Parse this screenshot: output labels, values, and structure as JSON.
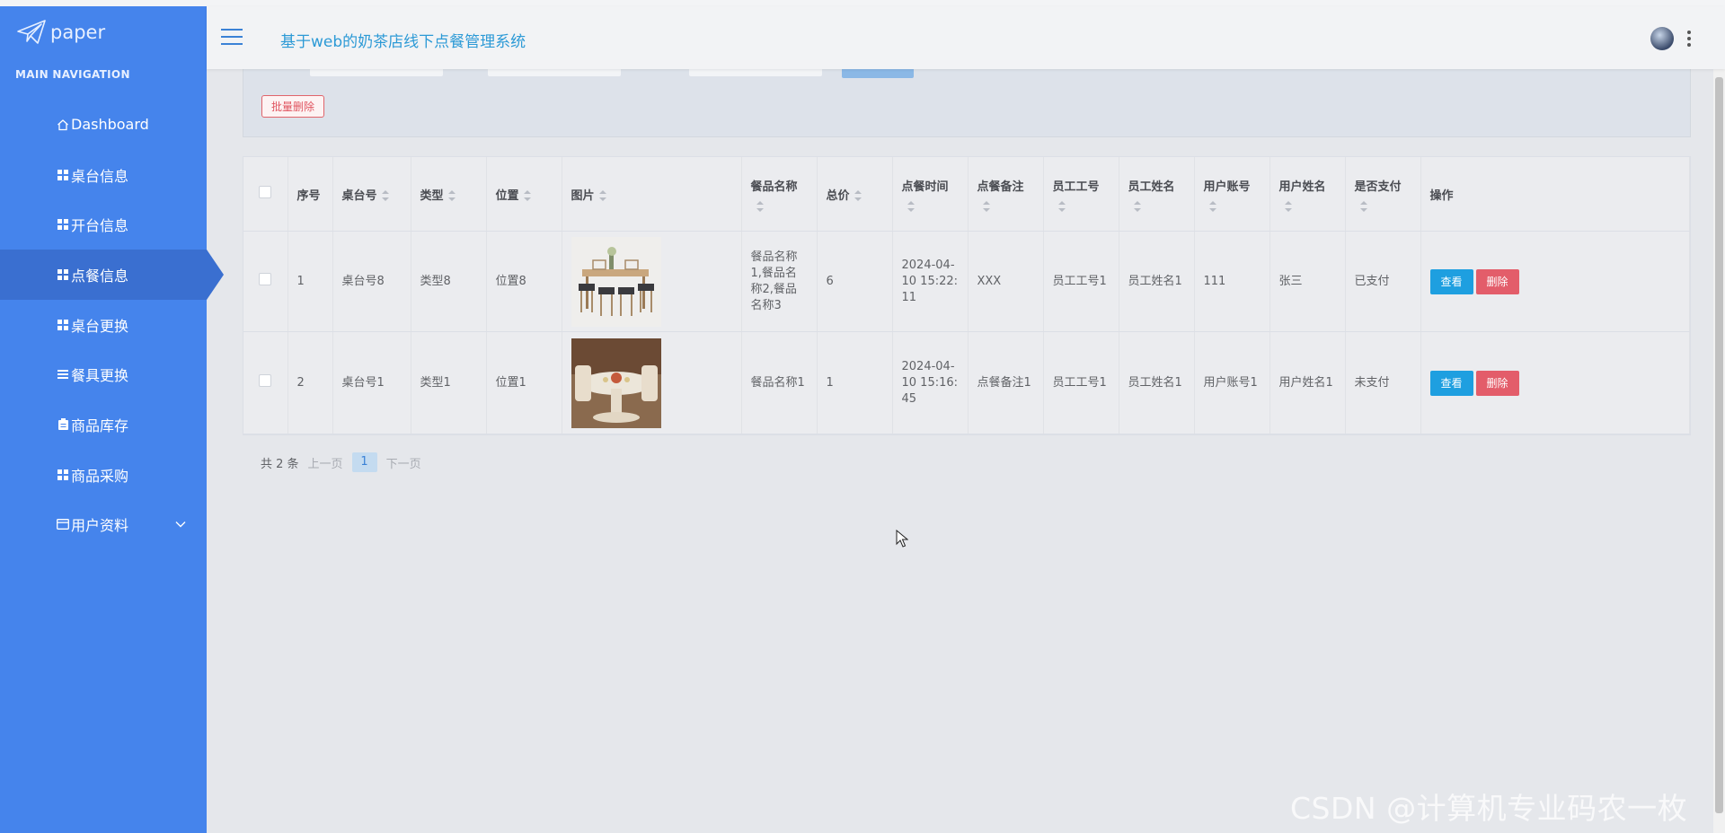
{
  "brand": {
    "logo_text": "paper"
  },
  "sidebar": {
    "nav_title": "MAIN NAVIGATION",
    "items": [
      {
        "label": "Dashboard",
        "icon": "home-icon"
      },
      {
        "label": "桌台信息",
        "icon": "grid-icon"
      },
      {
        "label": "开台信息",
        "icon": "grid-icon"
      },
      {
        "label": "点餐信息",
        "icon": "grid-icon",
        "active": true
      },
      {
        "label": "桌台更换",
        "icon": "grid-icon"
      },
      {
        "label": "餐具更换",
        "icon": "list-icon"
      },
      {
        "label": "商品库存",
        "icon": "clipboard-icon"
      },
      {
        "label": "商品采购",
        "icon": "grid-icon"
      },
      {
        "label": "用户资料",
        "icon": "card-icon",
        "expandable": true
      }
    ]
  },
  "header": {
    "title": "基于web的奶茶店线下点餐管理系统"
  },
  "toolbar": {
    "batch_delete_label": "批量删除"
  },
  "table": {
    "columns": [
      "序号",
      "桌台号",
      "类型",
      "位置",
      "图片",
      "餐品名称",
      "总价",
      "点餐时间",
      "点餐备注",
      "员工工号",
      "员工姓名",
      "用户账号",
      "用户姓名",
      "是否支付",
      "操作"
    ],
    "rows": [
      {
        "index": "1",
        "table_no": "桌台号8",
        "type": "类型8",
        "location": "位置8",
        "image": "table-chairs-photo",
        "dish_names": "餐品名称1,餐品名称2,餐品名称3",
        "total": "6",
        "order_time": "2024-04-10 15:22:11",
        "remark": "XXX",
        "staff_no": "员工工号1",
        "staff_name": "员工姓名1",
        "user_account": "111",
        "user_name": "张三",
        "paid": "已支付"
      },
      {
        "index": "2",
        "table_no": "桌台号1",
        "type": "类型1",
        "location": "位置1",
        "image": "round-table-photo",
        "dish_names": "餐品名称1",
        "total": "1",
        "order_time": "2024-04-10 15:16:45",
        "remark": "点餐备注1",
        "staff_no": "员工工号1",
        "staff_name": "员工姓名1",
        "user_account": "用户账号1",
        "user_name": "用户姓名1",
        "paid": "未支付"
      }
    ],
    "action_view": "查看",
    "action_delete": "删除"
  },
  "pagination": {
    "total_text": "共 2 条",
    "prev": "上一页",
    "current": "1",
    "next": "下一页"
  },
  "watermark": "CSDN @计算机专业码农一枚",
  "colors": {
    "sidebar": "#4584ec",
    "accent": "#2d9ad6",
    "view_button": "#1e9fe0",
    "delete_button": "#e35d6a"
  }
}
